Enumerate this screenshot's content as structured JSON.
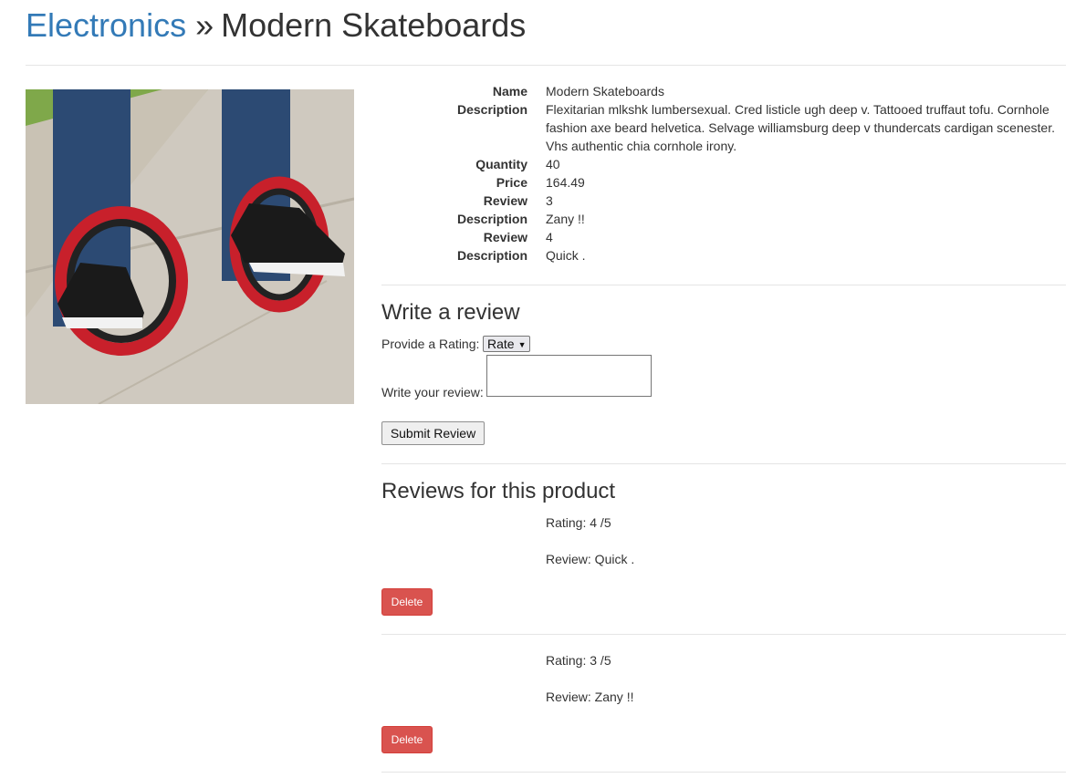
{
  "breadcrumb": {
    "category": "Electronics",
    "separator": "»",
    "product": "Modern Skateboards"
  },
  "product": {
    "image_alt": "Modern Skateboards",
    "details": [
      {
        "label": "Name",
        "value": "Modern Skateboards"
      },
      {
        "label": "Description",
        "value": "Flexitarian mlkshk lumbersexual. Cred listicle ugh deep v. Tattooed truffaut tofu. Cornhole fashion axe beard helvetica. Selvage williamsburg deep v thundercats cardigan scenester. Vhs authentic chia cornhole irony."
      },
      {
        "label": "Quantity",
        "value": "40"
      },
      {
        "label": "Price",
        "value": "164.49"
      },
      {
        "label": "Review",
        "value": "3"
      },
      {
        "label": "Description",
        "value": "Zany !!"
      },
      {
        "label": "Review",
        "value": "4"
      },
      {
        "label": "Description",
        "value": "Quick ."
      }
    ]
  },
  "review_form": {
    "title": "Write a review",
    "rating_label": "Provide a Rating:",
    "rating_select_value": "Rate",
    "review_label": "Write your review:",
    "review_value": "",
    "submit_label": "Submit Review"
  },
  "reviews": {
    "title": "Reviews for this product",
    "items": [
      {
        "rating": "Rating: 4 /5",
        "review": "Review: Quick .",
        "delete_label": "Delete"
      },
      {
        "rating": "Rating: 3 /5",
        "review": "Review: Zany !!",
        "delete_label": "Delete"
      }
    ]
  },
  "colors": {
    "link": "#337ab7",
    "danger": "#d9534f",
    "divider": "#e5e5e5"
  }
}
